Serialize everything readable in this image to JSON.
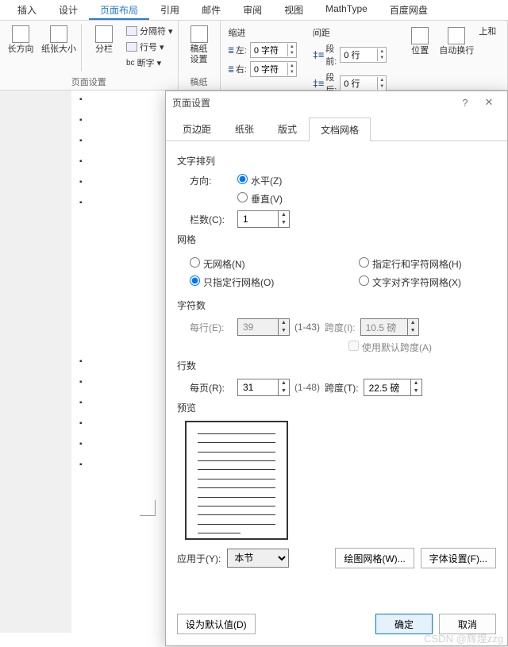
{
  "ribbon_tabs": [
    "插入",
    "设计",
    "页面布局",
    "引用",
    "邮件",
    "审阅",
    "视图",
    "MathType",
    "百度网盘"
  ],
  "active_tab_index": 2,
  "ribbon": {
    "text_dir": "长方向",
    "paper_size": "纸张大小",
    "columns": "分栏",
    "breaks": "分隔符",
    "line_num": "行号",
    "hyphen": "断字",
    "gaozhi": "稿纸\n设置",
    "gaozhi_group": "稿纸",
    "page_setup_group": "页面设置",
    "indent_header": "缩进",
    "indent_left": "左:",
    "indent_right": "右:",
    "indent_left_val": "0 字符",
    "indent_right_val": "0 字符",
    "spacing_header": "间距",
    "space_before": "段前:",
    "space_after": "段后:",
    "space_before_val": "0 行",
    "space_after_val": "0 行",
    "position": "位置",
    "wrap": "自动换行",
    "top": "上和"
  },
  "dialog": {
    "title": "页面设置",
    "tabs": [
      "页边距",
      "纸张",
      "版式",
      "文档网格"
    ],
    "active_tab": 3,
    "section_text_flow": "文字排列",
    "direction_label": "方向:",
    "horizontal": "水平(Z)",
    "vertical": "垂直(V)",
    "columns_label": "栏数(C):",
    "columns_val": "1",
    "section_grid": "网格",
    "no_grid": "无网格(N)",
    "line_grid": "只指定行网格(O)",
    "line_char_grid": "指定行和字符网格(H)",
    "align_char_grid": "文字对齐字符网格(X)",
    "section_chars": "字符数",
    "per_line": "每行(E):",
    "per_line_val": "39",
    "per_line_range": "(1-43)",
    "span_i": "跨度(I):",
    "span_i_val": "10.5 磅",
    "use_default_span": "使用默认跨度(A)",
    "section_lines": "行数",
    "per_page": "每页(R):",
    "per_page_val": "31",
    "per_page_range": "(1-48)",
    "span_t": "跨度(T):",
    "span_t_val": "22.5 磅",
    "section_preview": "预览",
    "apply_to": "应用于(Y):",
    "apply_val": "本节",
    "draw_grid": "绘图网格(W)...",
    "font_settings": "字体设置(F)...",
    "set_default": "设为默认值(D)",
    "ok": "确定",
    "cancel": "取消"
  },
  "watermark": "CSDN @辉煌zzg"
}
